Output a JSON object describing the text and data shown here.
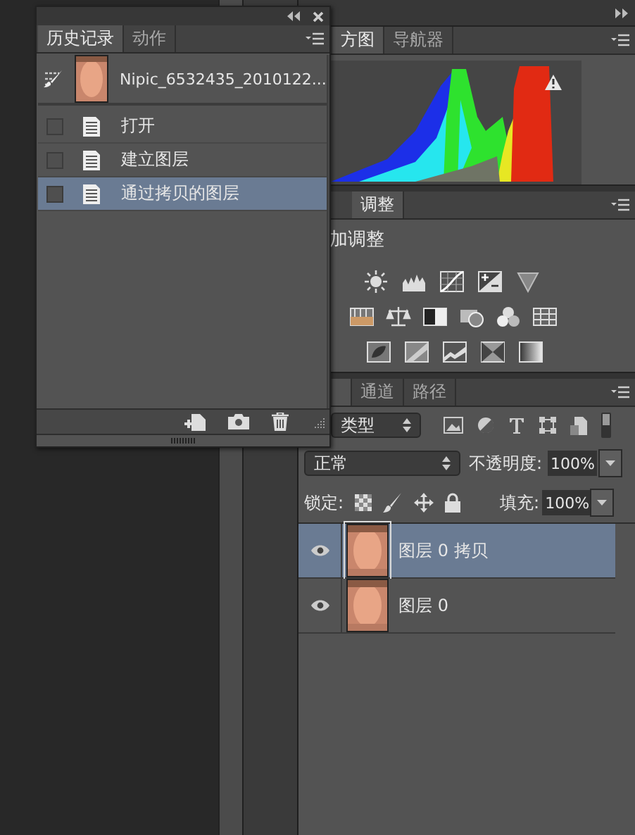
{
  "history_panel": {
    "tabs": [
      {
        "label": "历史记录",
        "selected": true
      },
      {
        "label": "动作",
        "selected": false
      }
    ],
    "snapshot": {
      "name": "Nipic_6532435_2010122..."
    },
    "states": [
      {
        "label": "打开",
        "selected": false
      },
      {
        "label": "建立图层",
        "selected": false
      },
      {
        "label": "通过拷贝的图层",
        "selected": true
      }
    ]
  },
  "histogram_panel": {
    "tabs": [
      {
        "label": "方图",
        "selected": true
      },
      {
        "label": "导航器",
        "selected": false
      }
    ]
  },
  "adjustments_panel": {
    "tabs": [
      {
        "label": "调整",
        "selected": true
      }
    ],
    "heading": "加调整"
  },
  "layers_panel": {
    "tabs": [
      {
        "label": "通道",
        "selected": false
      },
      {
        "label": "路径",
        "selected": false
      }
    ],
    "filter": {
      "value": "类型"
    },
    "blend_mode": {
      "value": "正常"
    },
    "opacity": {
      "label": "不透明度:",
      "value": "100%"
    },
    "lock_label": "锁定:",
    "fill": {
      "label": "填充:",
      "value": "100%"
    },
    "layers": [
      {
        "name": "图层 0 拷贝",
        "visible": true,
        "selected": true
      },
      {
        "name": "图层 0",
        "visible": true,
        "selected": false
      }
    ]
  }
}
